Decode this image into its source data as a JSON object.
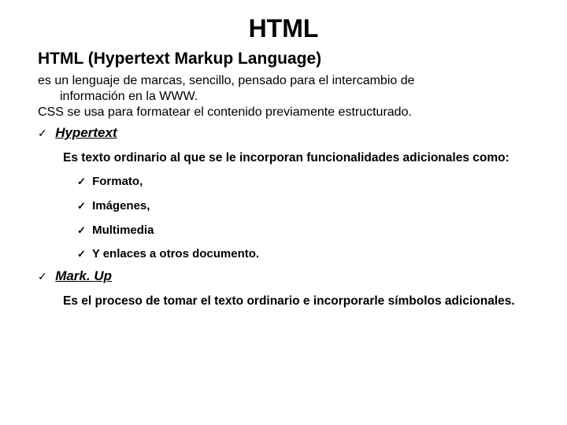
{
  "title": "HTML",
  "subtitle": "HTML (Hypertext Markup Language)",
  "intro": {
    "line1a": "es un lenguaje de marcas, sencillo, pensado para el intercambio de",
    "line1b": "información en la WWW.",
    "line2": "CSS se usa para formatear el contenido previamente estructurado."
  },
  "check": "✓",
  "sections": [
    {
      "term": "Hypertext",
      "desc": "Es texto ordinario al que se le incorporan funcionalidades adicionales como:",
      "items": [
        "Formato,",
        "Imágenes,",
        "Multimedia",
        "Y enlaces a otros documento."
      ]
    },
    {
      "term": "Mark. Up",
      "desc": "Es el proceso de tomar el texto ordinario e incorporarle símbolos adicionales."
    }
  ]
}
